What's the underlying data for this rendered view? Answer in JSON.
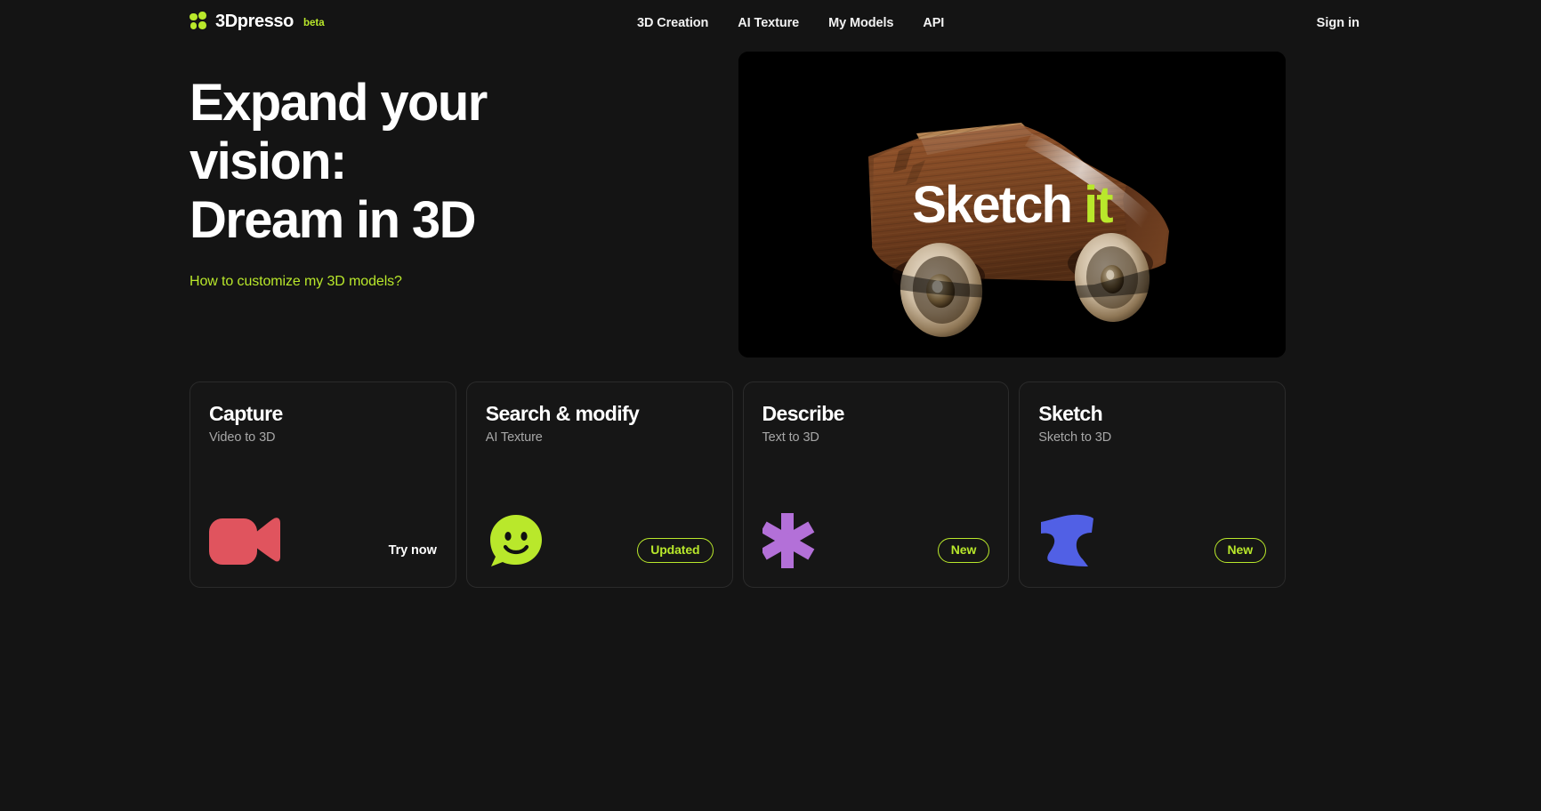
{
  "brand": {
    "name": "3Dpresso",
    "beta_label": "beta",
    "logo_icon": "four-dots-logo-icon",
    "accent_color": "#B9E82B"
  },
  "nav": {
    "items": [
      {
        "label": "3D Creation"
      },
      {
        "label": "AI Texture"
      },
      {
        "label": "My Models"
      },
      {
        "label": "API"
      }
    ],
    "sign_in_label": "Sign in"
  },
  "hero": {
    "headline": "Expand your\nvision:\nDream in 3D",
    "link_label": "How to customize my 3D models?",
    "media": {
      "subject": "wooden-toy-car-3d-render",
      "background_color": "#000000",
      "overlay_text_white": "Sketch",
      "overlay_text_accent": "it"
    }
  },
  "cards": [
    {
      "title": "Capture",
      "subtitle": "Video to 3D",
      "icon": "video-camera-icon",
      "icon_color": "#E0545E",
      "action_type": "link",
      "action_label": "Try now"
    },
    {
      "title": "Search & modify",
      "subtitle": "AI Texture",
      "icon": "smiley-speech-bubble-icon",
      "icon_color": "#B9E82B",
      "action_type": "badge",
      "action_label": "Updated"
    },
    {
      "title": "Describe",
      "subtitle": "Text to 3D",
      "icon": "asterisk-icon",
      "icon_color": "#B370D8",
      "action_type": "badge",
      "action_label": "New"
    },
    {
      "title": "Sketch",
      "subtitle": "Sketch to 3D",
      "icon": "sketch-blob-icon",
      "icon_color": "#5160E5",
      "action_type": "badge",
      "action_label": "New"
    }
  ],
  "theme": {
    "page_background": "#141414",
    "card_background": "#161616",
    "card_border": "#2b2b2b",
    "text_primary": "#ffffff",
    "text_secondary": "#a7a7a7"
  }
}
